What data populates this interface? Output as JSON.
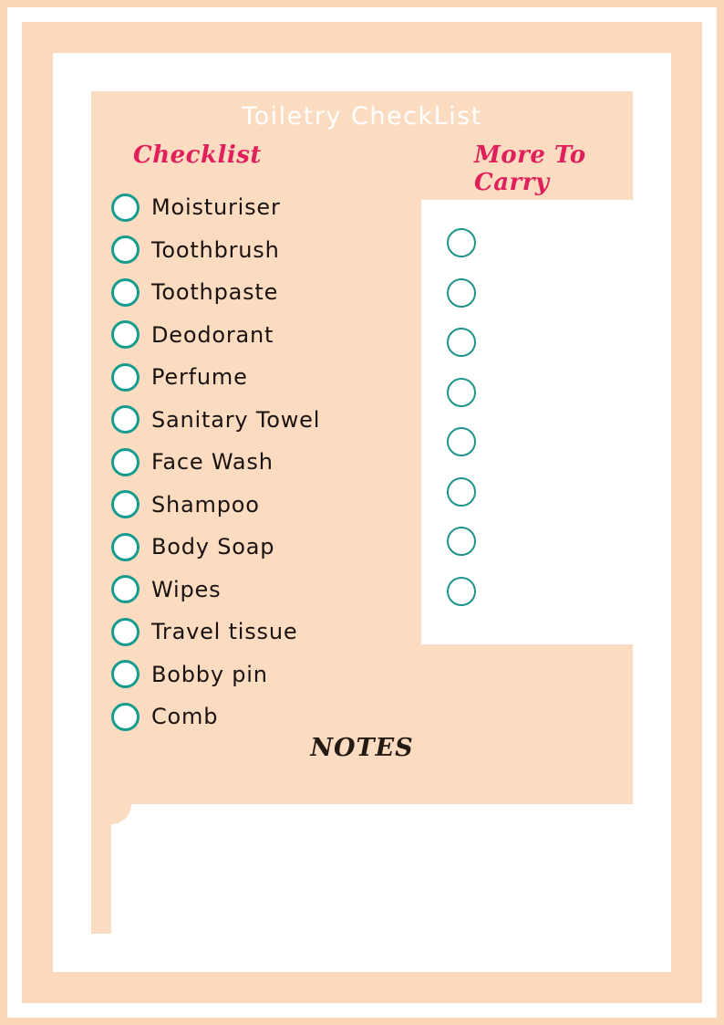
{
  "document": {
    "title": "Toiletry CheckList"
  },
  "sections": {
    "checklist": {
      "heading": "Checklist",
      "items": [
        {
          "label": "Moisturiser"
        },
        {
          "label": "Toothbrush"
        },
        {
          "label": "Toothpaste"
        },
        {
          "label": "Deodorant"
        },
        {
          "label": "Perfume"
        },
        {
          "label": "Sanitary Towel"
        },
        {
          "label": "Face Wash"
        },
        {
          "label": "Shampoo"
        },
        {
          "label": "Body Soap"
        },
        {
          "label": "Wipes"
        },
        {
          "label": "Travel tissue"
        },
        {
          "label": "Bobby pin"
        },
        {
          "label": "Comb"
        }
      ]
    },
    "more_to_carry": {
      "heading": "More To Carry",
      "blank_rows": 8,
      "items": [
        {
          "label": ""
        },
        {
          "label": ""
        },
        {
          "label": ""
        },
        {
          "label": ""
        },
        {
          "label": ""
        },
        {
          "label": ""
        },
        {
          "label": ""
        },
        {
          "label": ""
        }
      ]
    },
    "notes": {
      "heading": "NOTES",
      "value": "",
      "placeholder": ""
    }
  },
  "colors": {
    "page_background": "#ffffff",
    "frame_peach_outer": "#fbd7b8",
    "frame_peach_mid": "#fcd9bd",
    "canvas_peach": "#fcdcc0",
    "heading_pink": "#e01f5c",
    "checkbox_teal": "#169b8f",
    "checkbox_teal_light": "#1c948b",
    "title_white": "#ffffff",
    "text_dark": "#1a1210",
    "notes_heading": "#241a14",
    "card_white": "#ffffff"
  },
  "icons": {
    "checkbox": "circle-outline-icon"
  }
}
